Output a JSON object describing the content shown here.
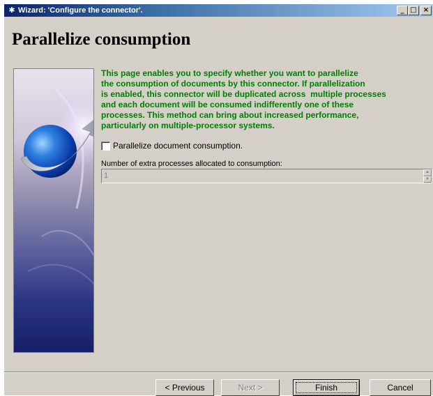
{
  "window": {
    "title": "Wizard: 'Configure the connector'.",
    "minimize_glyph": "_",
    "maximize_glyph": "□",
    "close_glyph": "×"
  },
  "page": {
    "title": "Parallelize consumption"
  },
  "description": "This page enables you to specify whether you want to parallelize\nthe consumption of documents by this connector. If parallelization\nis enabled, this connector will be duplicated across  multiple processes\nand each document will be consumed indifferently one of these\nprocesses. This method can bring about increased performance,\nparticularly on multiple-processor systems.",
  "checkbox": {
    "label": "Parallelize document consumption.",
    "checked": false
  },
  "extra_processes": {
    "label": "Number of extra processes allocated to consumption:",
    "value": "1"
  },
  "buttons": {
    "previous": "< Previous",
    "next": "Next >",
    "finish": "Finish",
    "cancel": "Cancel"
  },
  "colors": {
    "description_text": "#008000",
    "title_bar_start": "#0a246a",
    "dialog_face": "#d4d0c8"
  }
}
